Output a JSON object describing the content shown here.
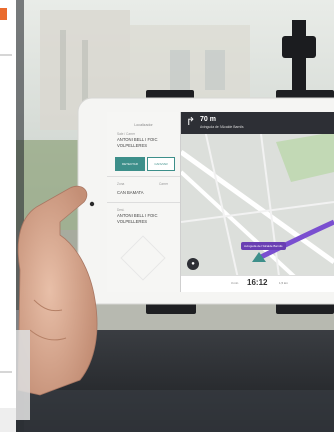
{
  "left_panel": {
    "title": "Localizador",
    "origin_label": "Sale / Carrer",
    "origin_value_line1": "ANTONI BELL I FOIC",
    "origin_value_line2": "VOLPELLERES",
    "primary_button": "DETECTAR",
    "secondary_button": "CANVIAR",
    "zone_label": "Zona",
    "zone_right_label": "Carrer",
    "zone_value": "CAN BAMATA",
    "dest_label": "Dest.",
    "dest_value_line1": "ANTONI BELL I FOIC",
    "dest_value_line2": "VOLPELLERES"
  },
  "navigation": {
    "distance": "70 m",
    "street": "Avinguda de l'Alcalde Barnils",
    "callout": "Avinguda de l'Alcalde Barnils",
    "eta_time": "16:12",
    "eta_label": "3 min",
    "distance_label": "1,5 km"
  },
  "colors": {
    "route": "#7a4fd0",
    "accent": "#3d8f8a",
    "nav_bar": "#2d2f35"
  }
}
